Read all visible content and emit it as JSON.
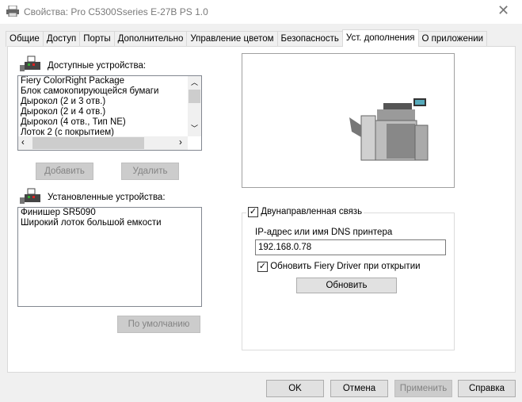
{
  "window": {
    "title": "Свойства: Pro C5300Sseries E-27B PS 1.0",
    "close": "✕"
  },
  "tabs": [
    "Общие",
    "Доступ",
    "Порты",
    "Дополнительно",
    "Управление цветом",
    "Безопасность",
    "Уст. дополнения",
    "О приложении"
  ],
  "available": {
    "label": "Доступные устройства:",
    "items": [
      "Fiery ColorRight Package",
      "Блок самокопирующейся бумаги",
      "Дырокол (2 и 3 отв.)",
      "Дырокол (2 и 4 отв.)",
      "Дырокол (4 отв., Тип NE)",
      "Лоток 2 (с покрытием)"
    ]
  },
  "buttons": {
    "add": "Добавить",
    "remove": "Удалить",
    "default": "По умолчанию",
    "update": "Обновить",
    "ok": "OK",
    "cancel": "Отмена",
    "apply": "Применить",
    "help": "Справка"
  },
  "installed": {
    "label": "Установленные устройства:",
    "items": [
      "Финишер SR5090",
      "Широкий лоток большой емкости"
    ]
  },
  "comm": {
    "bidirectional": "Двунаправленная связь",
    "ip_label": "IP-адрес или имя DNS принтера",
    "ip_value": "192.168.0.78",
    "update_on_open": "Обновить Fiery Driver при открытии"
  }
}
